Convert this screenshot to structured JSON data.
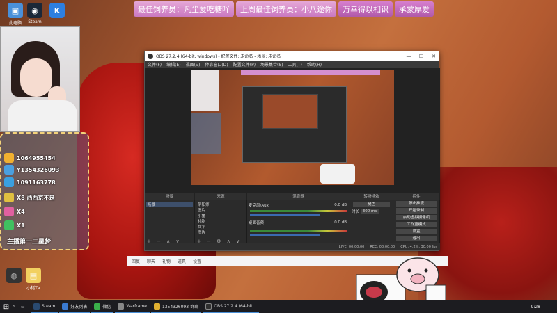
{
  "banner": [
    "最佳饲养员：凡尘爱吃糖吖",
    "上周最佳饲养员：小八途你",
    "万幸得以相识",
    "承蒙厚爱"
  ],
  "desktop_icons": [
    "此电脑",
    "Steam",
    "",
    "",
    "",
    "小猪TV"
  ],
  "gift_panel": {
    "rows": [
      {
        "text": "1064955454",
        "color": "#f0b030"
      },
      {
        "text": "Y1354326093",
        "color": "#4aa0e0"
      },
      {
        "text": "1091163778",
        "color": "#3aa0e0"
      },
      {
        "text": "X8 西西京不是",
        "color": "#e0c040"
      },
      {
        "text": "X4",
        "color": "#e060a0"
      },
      {
        "text": "X1",
        "color": "#40c060"
      }
    ],
    "title": "主播第一二星梦"
  },
  "obs": {
    "title": "OBS 27.2.4 (64-bit, windows) - 配置文件: 未命名 - 场景: 未命名",
    "menu": [
      "文件(F)",
      "编辑(E)",
      "视图(V)",
      "停靠窗口(D)",
      "配置文件(P)",
      "场景集合(S)",
      "工具(T)",
      "帮助(H)"
    ],
    "dock_titles": [
      "场景",
      "来源",
      "混音器",
      "转场特效",
      "控件"
    ],
    "scenes": [
      "场景"
    ],
    "sources": [
      "阴阳师",
      "图片",
      "小猪",
      "礼物",
      "文字",
      "图片"
    ],
    "mixer": [
      {
        "label": "麦克风/Aux",
        "db": "0.0 dB"
      },
      {
        "label": "桌面音频",
        "db": "0.0 dB"
      }
    ],
    "transition": {
      "type": "褪色",
      "duration_label": "时长",
      "duration": "300 ms"
    },
    "controls": [
      "停止推流",
      "开始录制",
      "启动虚拟摄像机",
      "工作室模式",
      "设置",
      "退出"
    ],
    "status": [
      "LIVE: 00:00:00",
      "REC: 00:00:00",
      "CPU: 4.2%, 30.00 fps"
    ]
  },
  "overlay_bar": [
    "回复",
    "聊天",
    "礼物",
    "道具",
    "设置"
  ],
  "taskbar": {
    "items": [
      {
        "label": "Steam",
        "color": "#2a4a70"
      },
      {
        "label": "好友列表",
        "color": "#3a7ad0"
      },
      {
        "label": "微信",
        "color": "#3ab04a"
      },
      {
        "label": "Warframe",
        "color": "#888888"
      },
      {
        "label": "1354326093-群聊",
        "color": "#e0b030"
      },
      {
        "label": "OBS 27.2.4 (64-bit...",
        "color": "#303030"
      }
    ],
    "clock": "9:28"
  }
}
